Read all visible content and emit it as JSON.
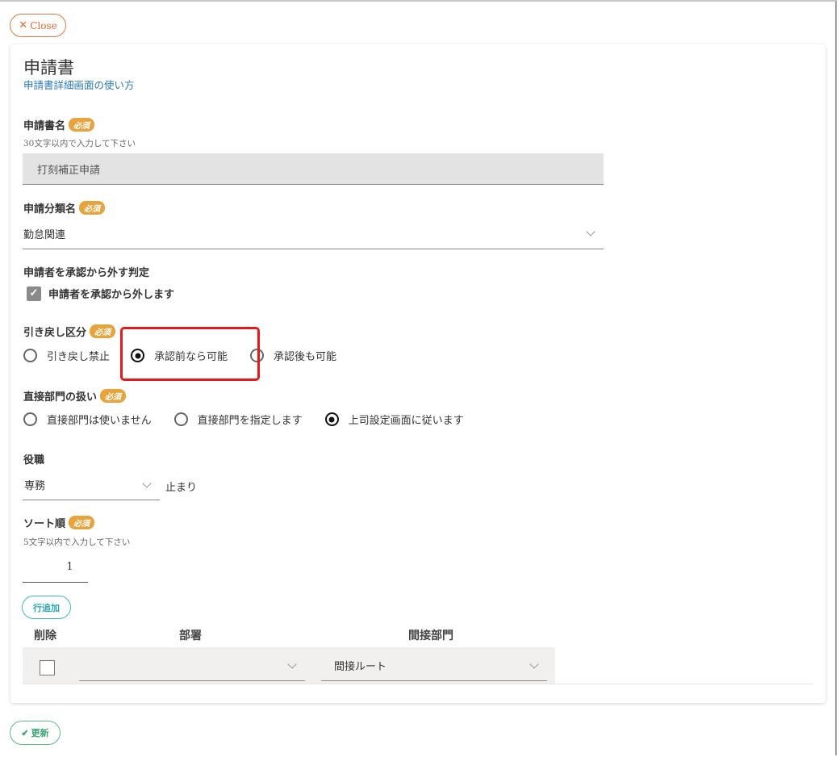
{
  "header": {
    "close_label": "Close",
    "title": "申請書",
    "help_link": "申請書詳細画面の使い方"
  },
  "required_badge": "必須",
  "form": {
    "app_name": {
      "label": "申請書名",
      "hint": "30文字以内で入力して下さい",
      "value": "打刻補正申請"
    },
    "category": {
      "label": "申請分類名",
      "value": "勤怠関連"
    },
    "exclude_applicant": {
      "label": "申請者を承認から外す判定",
      "checkbox_label": "申請者を承認から外します",
      "checked": true
    },
    "pullback": {
      "label": "引き戻し区分",
      "options": [
        "引き戻し禁止",
        "承認前なら可能",
        "承認後も可能"
      ],
      "selected": 1
    },
    "direct_dept": {
      "label": "直接部門の扱い",
      "options": [
        "直接部門は使いません",
        "直接部門を指定します",
        "上司設定画面に従います"
      ],
      "selected": 2
    },
    "position": {
      "label": "役職",
      "value": "専務",
      "suffix": "止まり"
    },
    "sort_order": {
      "label": "ソート順",
      "hint": "5文字以内で入力して下さい",
      "value": "1"
    }
  },
  "table": {
    "add_row_label": "行追加",
    "headers": [
      "削除",
      "部署",
      "間接部門"
    ],
    "rows": [
      {
        "delete": false,
        "department": "",
        "indirect": "間接ルート"
      }
    ]
  },
  "footer": {
    "update_label": "更新"
  },
  "colors": {
    "accent_orange": "#e07a45",
    "badge": "#e8a33c",
    "link": "#2a7ab8",
    "teal": "#3fbac5",
    "green": "#5dbb8b",
    "highlight_red": "#e21a1a"
  }
}
